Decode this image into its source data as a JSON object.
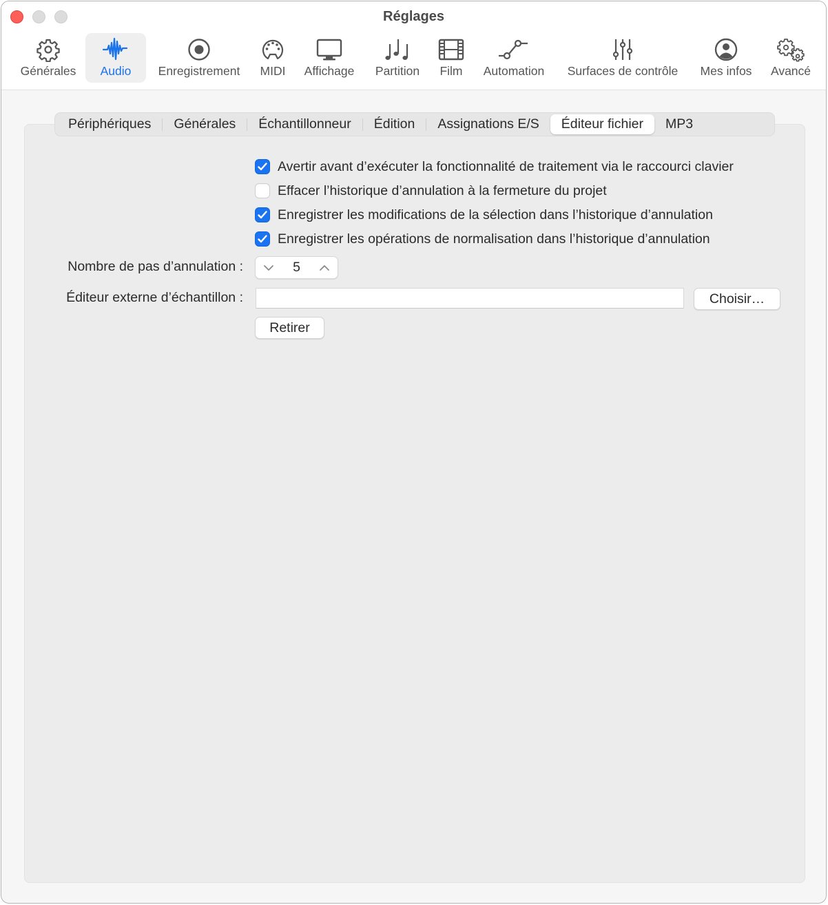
{
  "window": {
    "title": "Réglages"
  },
  "toolbar": {
    "items": [
      {
        "label": "Générales",
        "icon": "gear-icon",
        "active": false
      },
      {
        "label": "Audio",
        "icon": "waveform-icon",
        "active": true
      },
      {
        "label": "Enregistrement",
        "icon": "record-icon",
        "active": false
      },
      {
        "label": "MIDI",
        "icon": "midi-connector-icon",
        "active": false
      },
      {
        "label": "Affichage",
        "icon": "monitor-icon",
        "active": false
      },
      {
        "label": "Partition",
        "icon": "music-notes-icon",
        "active": false
      },
      {
        "label": "Film",
        "icon": "film-icon",
        "active": false
      },
      {
        "label": "Automation",
        "icon": "automation-curve-icon",
        "active": false
      },
      {
        "label": "Surfaces de contrôle",
        "icon": "sliders-icon",
        "active": false
      },
      {
        "label": "Mes infos",
        "icon": "person-circle-icon",
        "active": false
      },
      {
        "label": "Avancé",
        "icon": "gears-icon",
        "active": false
      }
    ]
  },
  "tabs": [
    {
      "label": "Périphériques",
      "active": false
    },
    {
      "label": "Générales",
      "active": false
    },
    {
      "label": "Échantillonneur",
      "active": false
    },
    {
      "label": "Édition",
      "active": false
    },
    {
      "label": "Assignations E/S",
      "active": false
    },
    {
      "label": "Éditeur fichier",
      "active": true
    },
    {
      "label": "MP3",
      "active": false
    }
  ],
  "options": [
    {
      "label": "Avertir avant d’exécuter la fonctionnalité de traitement via le raccourci clavier",
      "checked": true
    },
    {
      "label": "Effacer l’historique d’annulation à la fermeture du projet",
      "checked": false
    },
    {
      "label": "Enregistrer les modifications de la sélection dans l’historique d’annulation",
      "checked": true
    },
    {
      "label": "Enregistrer les opérations de normalisation dans l’historique d’annulation",
      "checked": true
    }
  ],
  "undo_steps": {
    "label": "Nombre de pas d’annulation :",
    "value": "5"
  },
  "external_editor": {
    "label": "Éditeur externe d’échantillon :",
    "value": "",
    "choose_label": "Choisir…",
    "remove_label": "Retirer"
  },
  "colors": {
    "accent": "#1a73e8",
    "checkbox": "#1a73f0",
    "close": "#fe5f57"
  }
}
